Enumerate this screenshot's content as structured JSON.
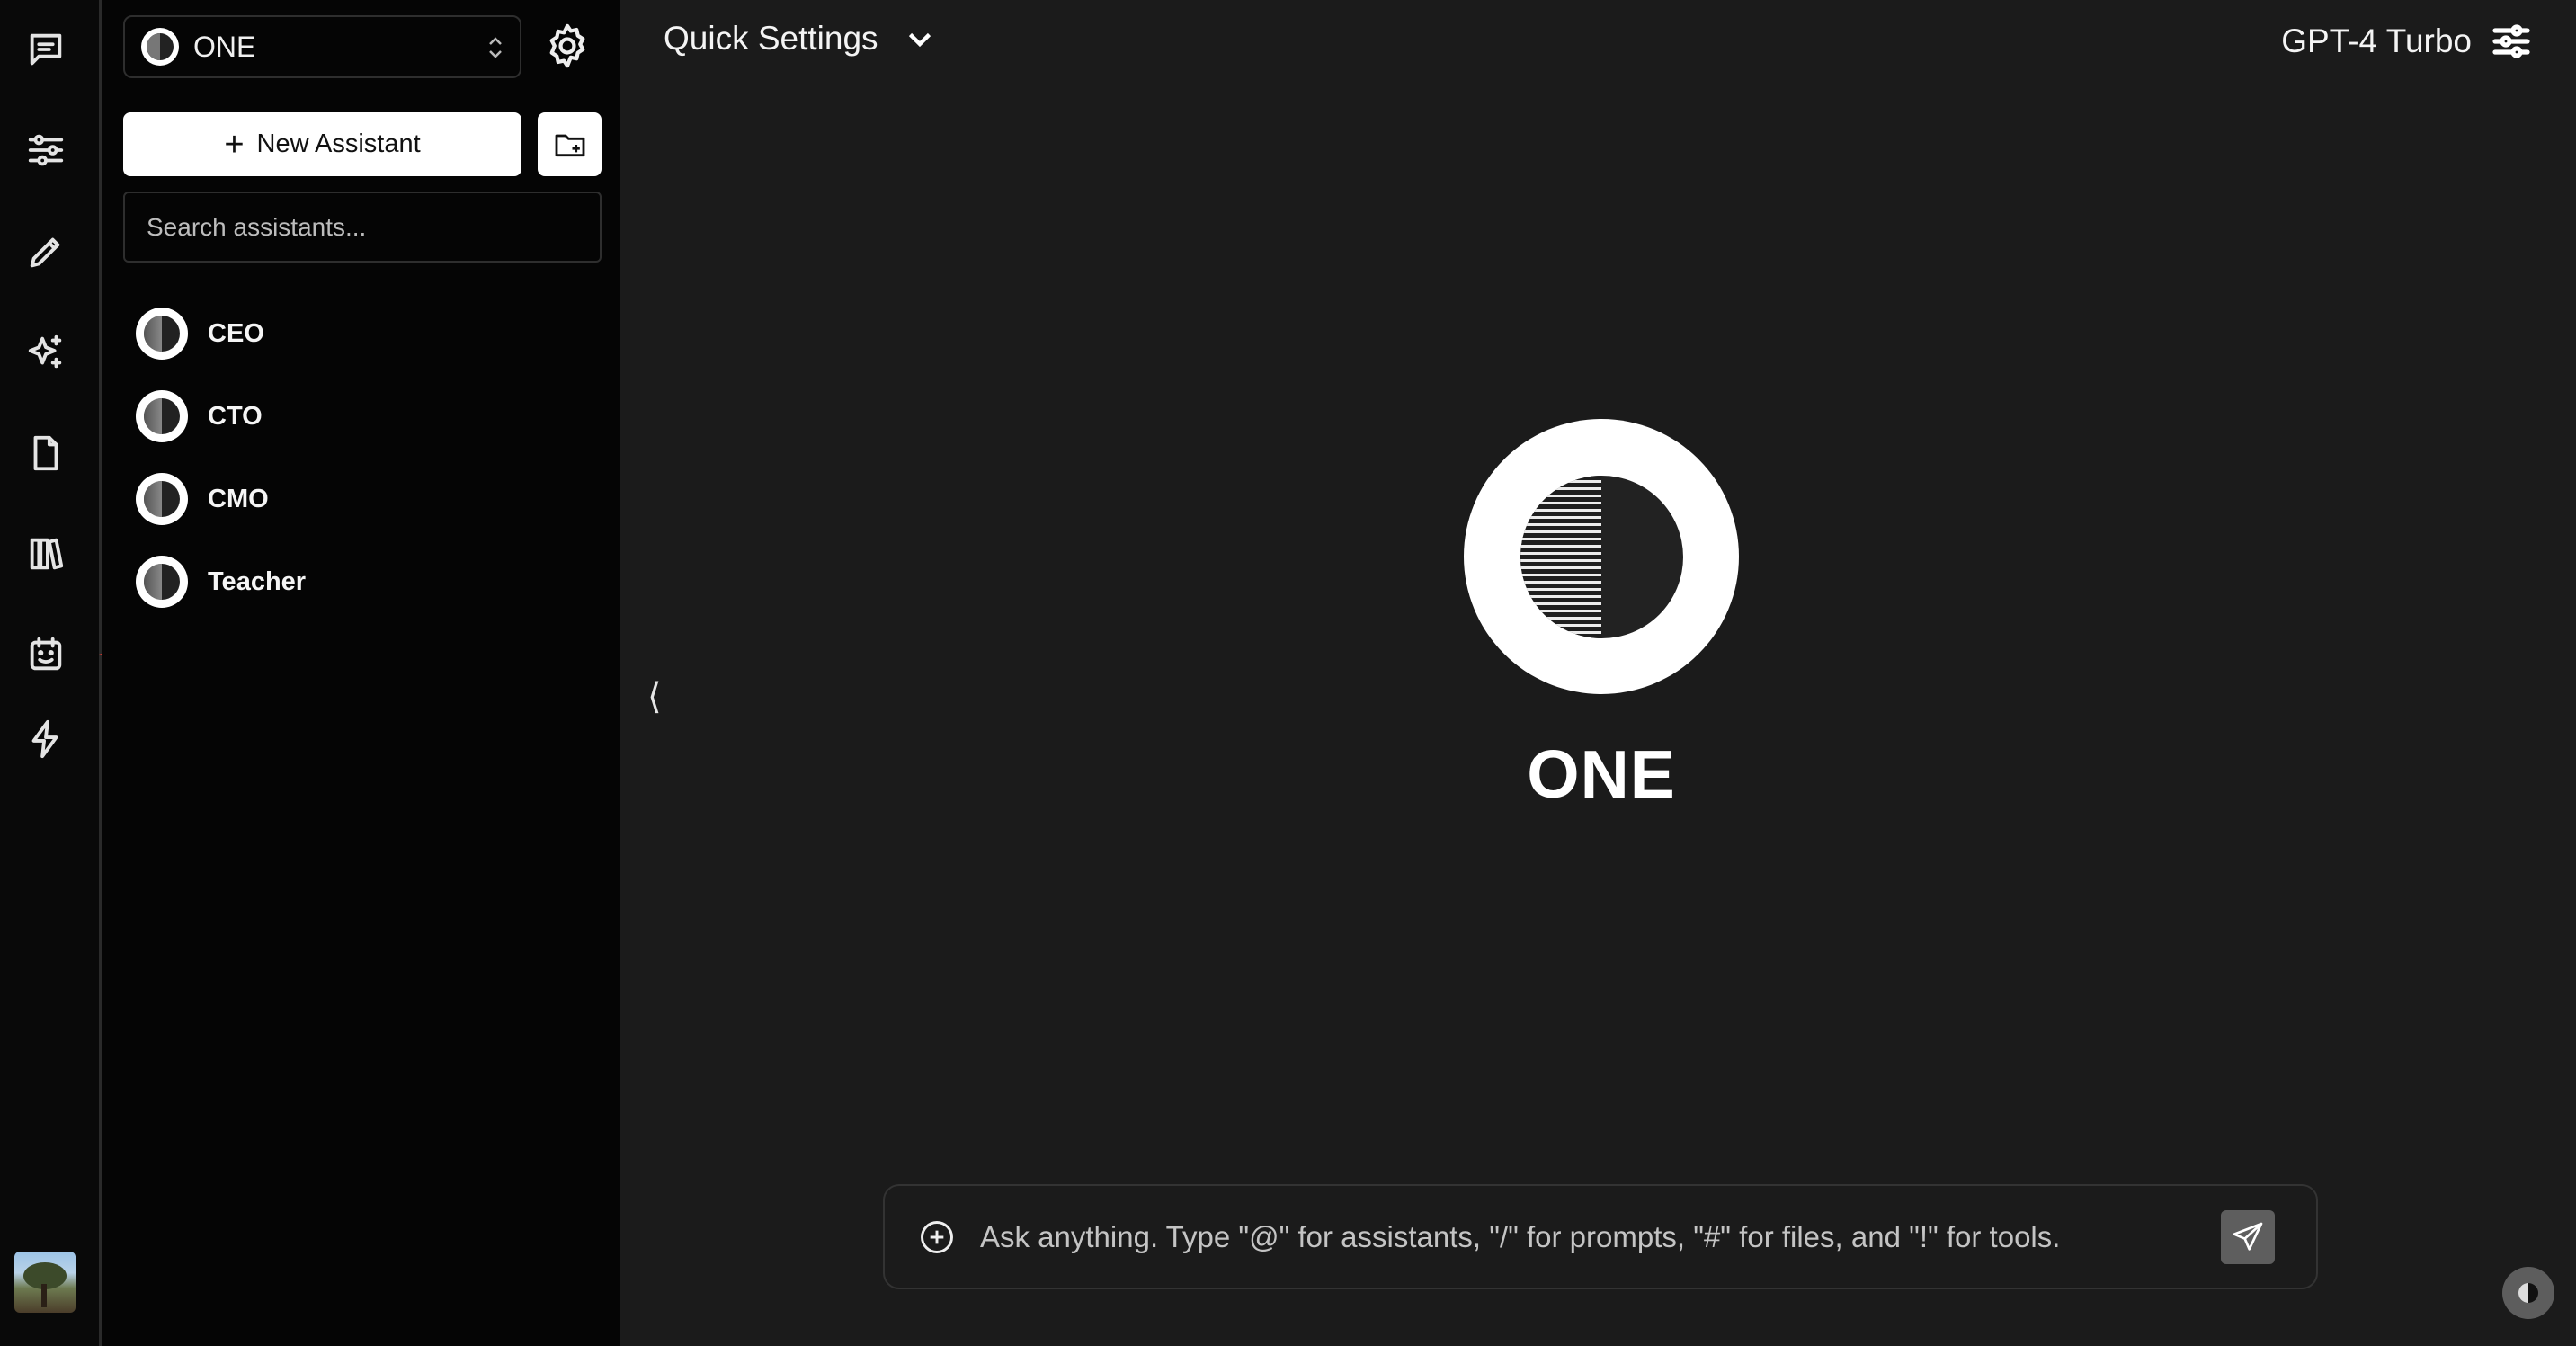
{
  "rail": {
    "icons": [
      "chat-icon",
      "sliders-icon",
      "pencil-icon",
      "sparkles-icon",
      "document-icon",
      "library-icon",
      "bot-icon",
      "lightning-icon"
    ]
  },
  "sidebar": {
    "selector": {
      "label": "ONE"
    },
    "new_assistant_label": "New Assistant",
    "search": {
      "placeholder": "Search assistants..."
    },
    "assistants": [
      {
        "name": "CEO"
      },
      {
        "name": "CTO"
      },
      {
        "name": "CMO"
      },
      {
        "name": "Teacher"
      }
    ]
  },
  "header": {
    "quick_settings": "Quick Settings",
    "model": "GPT-4 Turbo"
  },
  "main": {
    "collapse_glyph": "⟨",
    "title": "ONE"
  },
  "composer": {
    "placeholder": "Ask anything. Type \"@\" for assistants, \"/\" for prompts, \"#\" for files, and \"!\" for tools."
  },
  "colors": {
    "background": "#1b1b1b",
    "sidebar": "#050505",
    "rail": "#090909",
    "annotation_arrow": "#e03a2e"
  }
}
